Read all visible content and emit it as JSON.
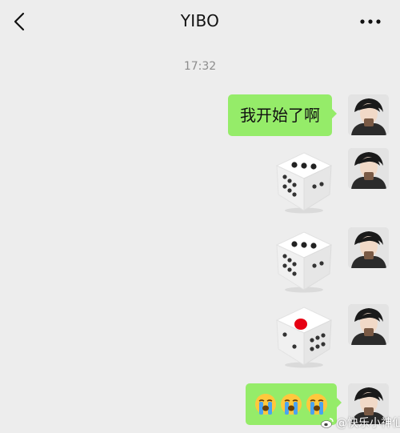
{
  "header": {
    "title": "YIBO",
    "back_icon": "chevron-left-icon",
    "more_icon": "ellipsis-icon"
  },
  "chat": {
    "timestamp": "17:32",
    "messages": [
      {
        "type": "text",
        "text": "我开始了啊"
      },
      {
        "type": "dice",
        "value": 3
      },
      {
        "type": "dice",
        "value": 3
      },
      {
        "type": "dice",
        "value": 1
      },
      {
        "type": "emoji",
        "emojis": [
          "😭",
          "😭",
          "😭"
        ]
      }
    ]
  },
  "watermark": {
    "text": "@快乐小神仙_",
    "icon": "weibo-logo"
  },
  "colors": {
    "background": "#ededed",
    "bubble": "#95ec69",
    "timestamp": "#8c8c8c",
    "dice_pip_red": "#e60012"
  }
}
